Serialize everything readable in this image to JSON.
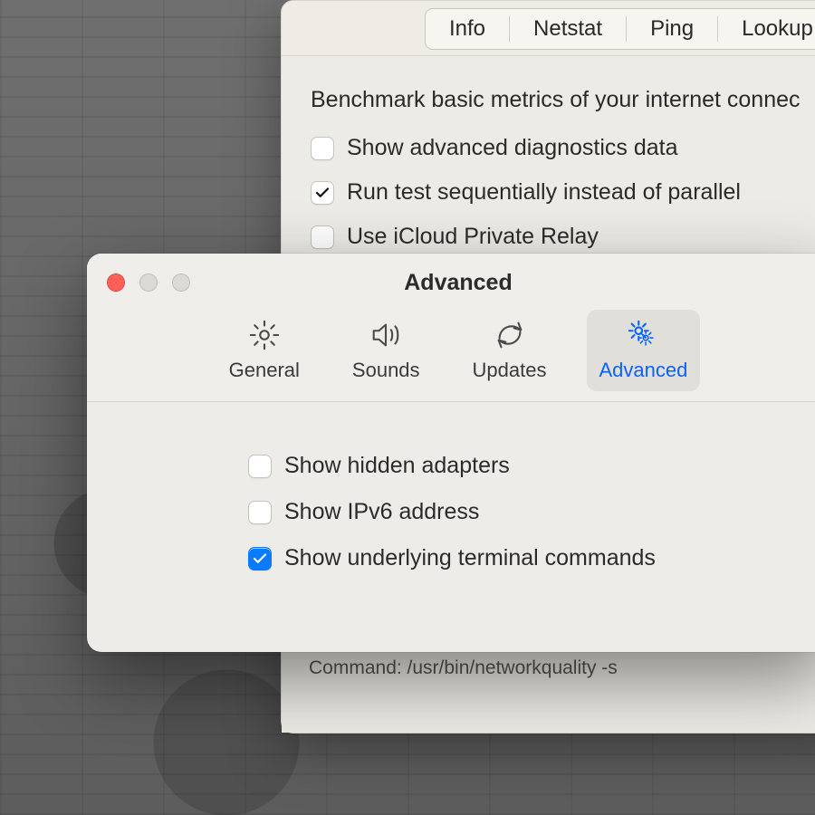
{
  "backWindow": {
    "tabs": [
      "Info",
      "Netstat",
      "Ping",
      "Lookup"
    ],
    "heading": "Benchmark basic metrics of your internet connec",
    "options": [
      {
        "label": "Show advanced diagnostics data",
        "checked": false
      },
      {
        "label": "Run test sequentially instead of parallel",
        "checked": true
      },
      {
        "label": "Use iCloud Private Relay",
        "checked": false
      }
    ],
    "footer": "Command: /usr/bin/networkquality -s"
  },
  "frontWindow": {
    "title": "Advanced",
    "toolbar": [
      {
        "id": "general",
        "label": "General",
        "icon": "gear-icon",
        "active": false
      },
      {
        "id": "sounds",
        "label": "Sounds",
        "icon": "speaker-icon",
        "active": false
      },
      {
        "id": "updates",
        "label": "Updates",
        "icon": "refresh-icon",
        "active": false
      },
      {
        "id": "advanced",
        "label": "Advanced",
        "icon": "gears-icon",
        "active": true
      }
    ],
    "options": [
      {
        "label": "Show hidden adapters",
        "checked": false
      },
      {
        "label": "Show IPv6 address",
        "checked": false
      },
      {
        "label": "Show underlying terminal commands",
        "checked": true
      }
    ]
  }
}
